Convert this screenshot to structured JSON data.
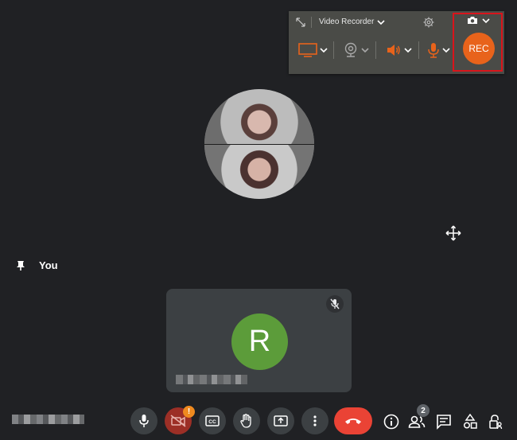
{
  "recorder": {
    "mode_label": "Video Recorder",
    "rec_label": "REC",
    "accent_color": "#e8631b",
    "highlight_color": "#d9141b",
    "sources": [
      {
        "name": "display",
        "icon": "monitor-icon"
      },
      {
        "name": "webcam",
        "icon": "webcam-icon"
      },
      {
        "name": "system-sound",
        "icon": "speaker-icon"
      },
      {
        "name": "microphone",
        "icon": "microphone-icon"
      }
    ],
    "camera_icon": "camera-icon"
  },
  "stage": {
    "pinned_label": "You",
    "move_icon": "move-icon"
  },
  "self_tile": {
    "avatar_letter": "R",
    "avatar_color": "#5c9c3a",
    "mic_status": "muted"
  },
  "controls": {
    "camera_warning": "!",
    "people_count": "2",
    "hangup_color": "#ea4335"
  }
}
